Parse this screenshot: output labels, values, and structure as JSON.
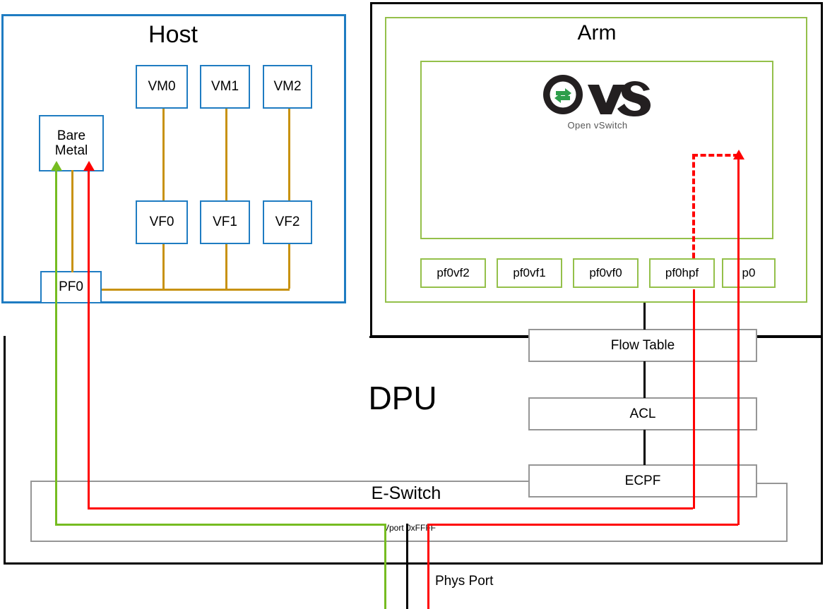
{
  "diagram": {
    "title_host": "Host",
    "title_arm": "Arm",
    "title_dpu": "DPU",
    "eswitch_label": "E-Switch",
    "vport_label": "Vport 0xFFFF",
    "phys_port_label": "Phys Port"
  },
  "host": {
    "bare_metal": "Bare\nMetal",
    "pf0": "PF0",
    "vms": [
      "VM0",
      "VM1",
      "VM2"
    ],
    "vfs": [
      "VF0",
      "VF1",
      "VF2"
    ]
  },
  "arm": {
    "ovs": {
      "mark": "OvS",
      "wordmark": "Open vSwitch"
    },
    "ports": [
      "pf0vf2",
      "pf0vf1",
      "pf0vf0",
      "pf0hpf",
      "p0"
    ]
  },
  "dpu": {
    "stages": [
      "Flow Table",
      "ACL",
      "ECPF"
    ]
  },
  "colors": {
    "host_blue": "#1F7CC2",
    "arm_green": "#94C04A",
    "link_orange": "#C89211",
    "flow_red": "#FF0000",
    "flow_green": "#76BC21",
    "box_gray": "#969696",
    "outline_black": "#000000"
  }
}
